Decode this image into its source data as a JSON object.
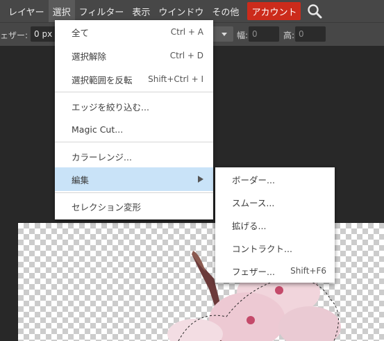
{
  "menubar": {
    "items": [
      "レイヤー",
      "選択",
      "フィルター",
      "表示",
      "ウインドウ",
      "その他"
    ],
    "account_label": "アカウント",
    "search_icon": "search-icon"
  },
  "options": {
    "feather_label": "ェザー:",
    "feather_value": "0  px",
    "width_label": "幅:",
    "width_value": "0",
    "height_label": "高:",
    "height_value": "0"
  },
  "select_menu": {
    "items": [
      {
        "label": "全て",
        "shortcut": "Ctrl + A"
      },
      {
        "label": "選択解除",
        "shortcut": "Ctrl + D"
      },
      {
        "label": "選択範囲を反転",
        "shortcut": "Shift+Ctrl + I"
      },
      {
        "label": "エッジを絞り込む..."
      },
      {
        "label": "Magic Cut..."
      },
      {
        "label": "カラーレンジ..."
      },
      {
        "label": "編集"
      },
      {
        "label": "セレクション変形"
      }
    ]
  },
  "edit_submenu": {
    "items": [
      {
        "label": "ボーダー..."
      },
      {
        "label": "スムース..."
      },
      {
        "label": "拡げる..."
      },
      {
        "label": "コントラクト..."
      },
      {
        "label": "フェザー...",
        "shortcut": "Shift+F6"
      }
    ]
  },
  "colors": {
    "menubar_bg": "#474747",
    "workspace_bg": "#282828",
    "account_bg": "#cc2b1b",
    "menu_highlight": "#c9e3f8"
  }
}
